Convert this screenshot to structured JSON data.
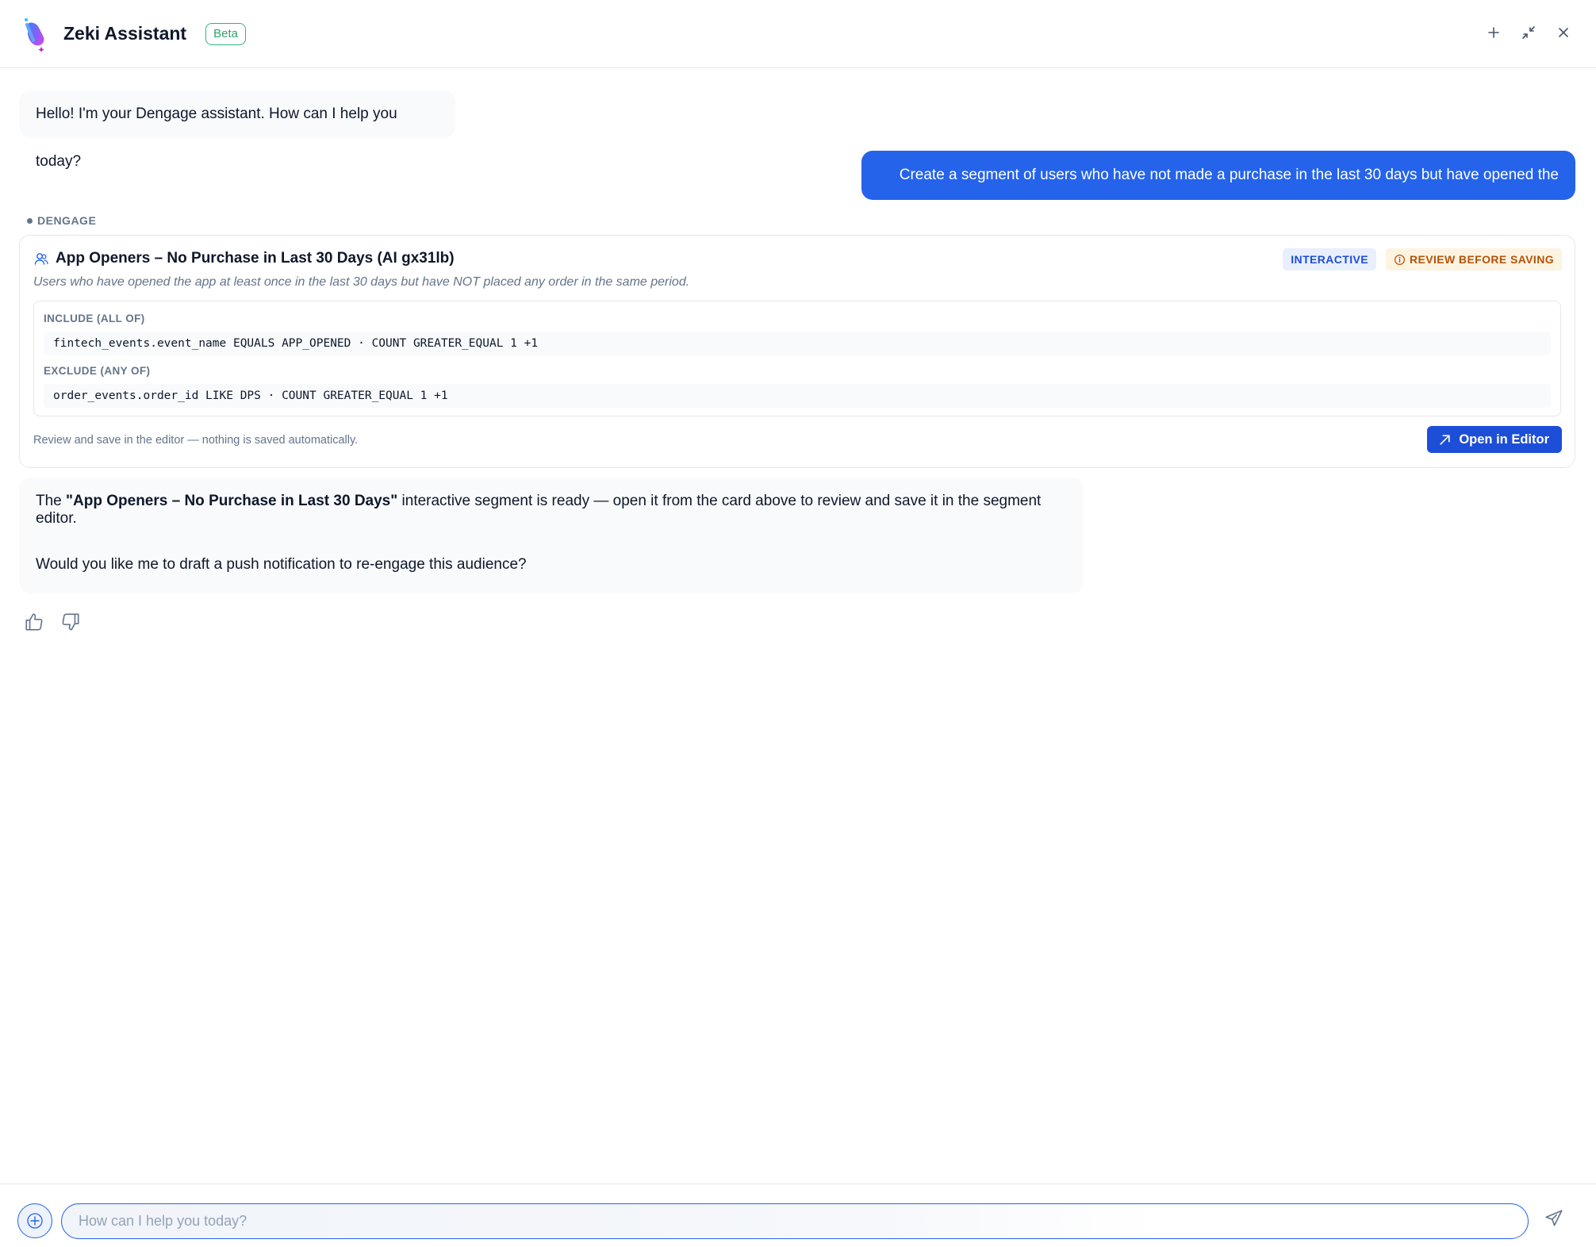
{
  "header": {
    "title": "Zeki Assistant",
    "badge": "Beta",
    "actions": [
      "plus-icon",
      "minimize-icon",
      "close-icon"
    ]
  },
  "messages": {
    "greeting": "Hello! I'm your Dengage assistant. How can I help you today?",
    "user_request": "Create a segment of users who have not made a purchase in the last 30 days but have opened the app.",
    "source_label": "DENGAGE",
    "reply": {
      "prefix": "The ",
      "segment_name": "\"App Openers – No Purchase in Last 30 Days\"",
      "suffix": " interactive segment is ready — open it from the card above to review and save it in the segment editor.",
      "followup": "Would you like me to draft a push notification to re-engage this audience?"
    }
  },
  "segment_card": {
    "title": "App Openers – No Purchase in Last 30 Days (AI gx31lb)",
    "badge_interactive": "INTERACTIVE",
    "badge_review": "REVIEW BEFORE SAVING",
    "description": "Users who have opened the app at least once in the last 30 days but have NOT placed any order in the same period.",
    "include_label": "INCLUDE (ALL OF)",
    "include_rule": "fintech_events.event_name EQUALS APP_OPENED · COUNT GREATER_EQUAL 1 +1",
    "exclude_label": "EXCLUDE (ANY OF)",
    "exclude_rule": "order_events.order_id LIKE DPS · COUNT GREATER_EQUAL 1 +1",
    "footer_note": "Review and save in the editor — nothing is saved automatically.",
    "open_button": "Open in Editor"
  },
  "composer": {
    "placeholder": "How can I help you today?",
    "value": ""
  },
  "colors": {
    "accent": "#2563eb",
    "brand_green": "#34b27a",
    "warning": "#b45309"
  }
}
